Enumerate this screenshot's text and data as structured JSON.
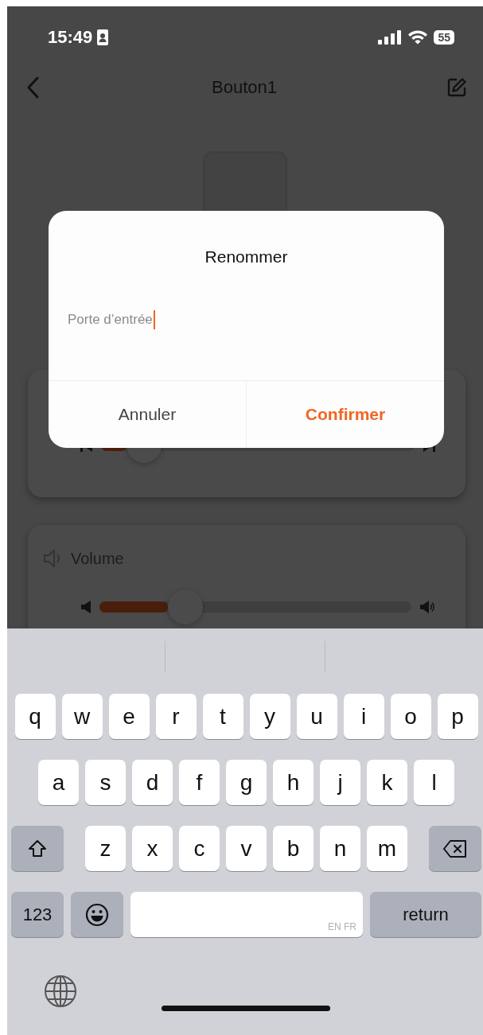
{
  "status_bar": {
    "time": "15:49",
    "battery": "55"
  },
  "nav": {
    "title": "Bouton1"
  },
  "cards": [
    {
      "kind": "seek",
      "level": 0.08
    },
    {
      "kind": "volume",
      "label": "Volume",
      "level": 0.22
    }
  ],
  "dialog": {
    "title": "Renommer",
    "input": {
      "value": "Porte d’entrée"
    },
    "buttons": [
      {
        "kind": "cancel",
        "label": "Annuler"
      },
      {
        "kind": "confirm",
        "label": "Confirmer"
      }
    ]
  },
  "keyboard": {
    "rows": [
      {
        "keys": [
          {
            "kind": "letter",
            "label": "q"
          },
          {
            "kind": "letter",
            "label": "w"
          },
          {
            "kind": "letter",
            "label": "e"
          },
          {
            "kind": "letter",
            "label": "r"
          },
          {
            "kind": "letter",
            "label": "t"
          },
          {
            "kind": "letter",
            "label": "y"
          },
          {
            "kind": "letter",
            "label": "u"
          },
          {
            "kind": "letter",
            "label": "i"
          },
          {
            "kind": "letter",
            "label": "o"
          },
          {
            "kind": "letter",
            "label": "p"
          }
        ]
      },
      {
        "keys": [
          {
            "kind": "letter",
            "label": "a"
          },
          {
            "kind": "letter",
            "label": "s"
          },
          {
            "kind": "letter",
            "label": "d"
          },
          {
            "kind": "letter",
            "label": "f"
          },
          {
            "kind": "letter",
            "label": "g"
          },
          {
            "kind": "letter",
            "label": "h"
          },
          {
            "kind": "letter",
            "label": "j"
          },
          {
            "kind": "letter",
            "label": "k"
          },
          {
            "kind": "letter",
            "label": "l"
          }
        ]
      },
      {
        "keys": [
          {
            "kind": "shift"
          },
          {
            "kind": "letter",
            "label": "z"
          },
          {
            "kind": "letter",
            "label": "x"
          },
          {
            "kind": "letter",
            "label": "c"
          },
          {
            "kind": "letter",
            "label": "v"
          },
          {
            "kind": "letter",
            "label": "b"
          },
          {
            "kind": "letter",
            "label": "n"
          },
          {
            "kind": "letter",
            "label": "m"
          },
          {
            "kind": "delete"
          }
        ]
      },
      {
        "keys": [
          {
            "kind": "numbers",
            "label": "123"
          },
          {
            "kind": "emoji"
          },
          {
            "kind": "space",
            "label": "EN FR"
          },
          {
            "kind": "return",
            "label": "return"
          }
        ]
      }
    ]
  }
}
